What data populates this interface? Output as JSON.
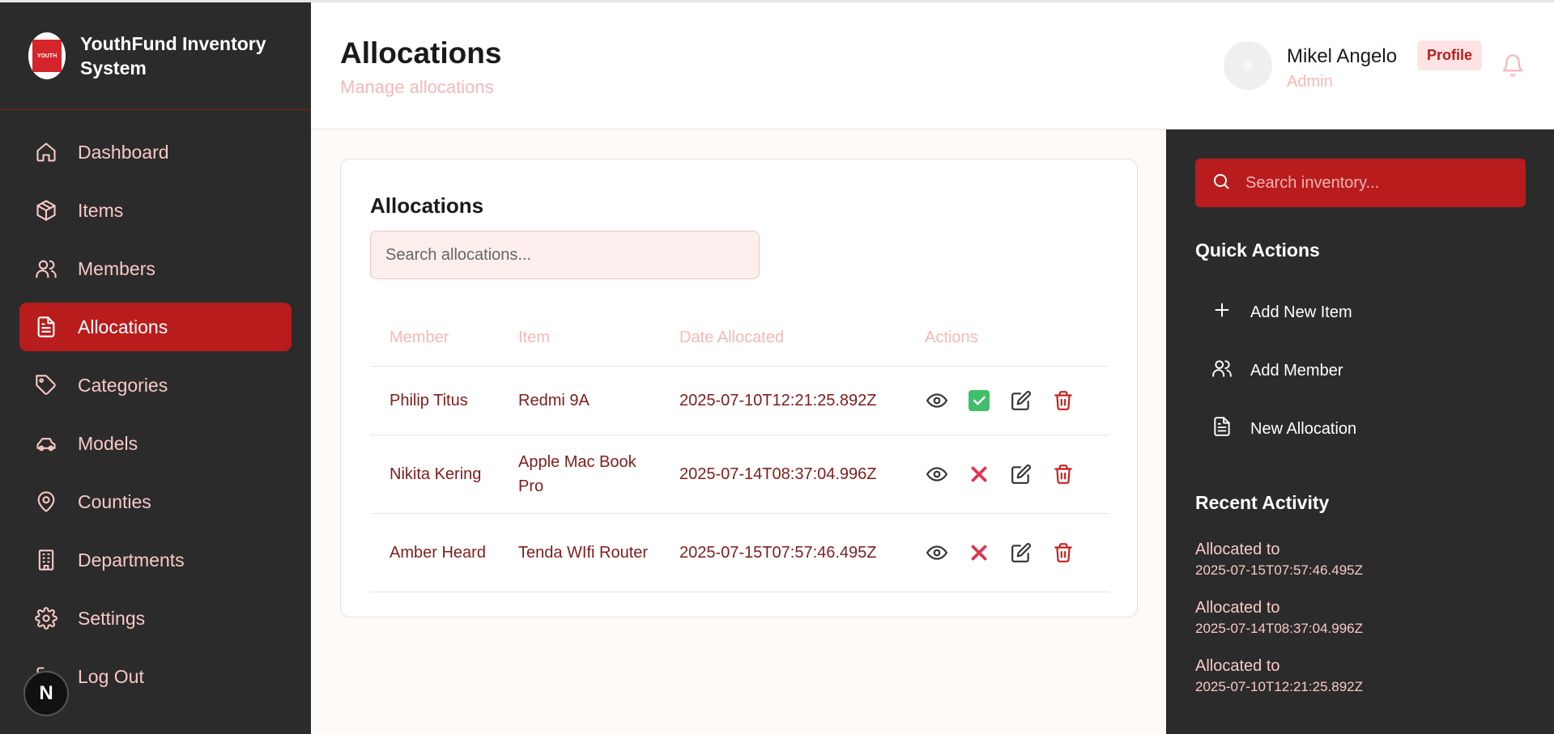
{
  "brand": {
    "title": "YouthFund Inventory System",
    "logo_text": "YOUTH"
  },
  "sidebar": {
    "items": [
      {
        "label": "Dashboard",
        "icon": "home-icon"
      },
      {
        "label": "Items",
        "icon": "box-icon"
      },
      {
        "label": "Members",
        "icon": "users-icon"
      },
      {
        "label": "Allocations",
        "icon": "file-icon",
        "active": true
      },
      {
        "label": "Categories",
        "icon": "tag-icon"
      },
      {
        "label": "Models",
        "icon": "car-icon"
      },
      {
        "label": "Counties",
        "icon": "map-pin-icon"
      },
      {
        "label": "Departments",
        "icon": "building-icon"
      },
      {
        "label": "Settings",
        "icon": "gear-icon"
      },
      {
        "label": "Log Out",
        "icon": "logout-icon"
      }
    ]
  },
  "header": {
    "title": "Allocations",
    "subtitle": "Manage allocations",
    "user_name": "Mikel Angelo",
    "user_role": "Admin",
    "profile_label": "Profile"
  },
  "main": {
    "card_title": "Allocations",
    "search_placeholder": "Search allocations...",
    "columns": [
      "Member",
      "Item",
      "Date Allocated",
      "Actions"
    ],
    "rows": [
      {
        "member": "Philip Titus",
        "item": "Redmi 9A",
        "date": "2025-07-10T12:21:25.892Z",
        "status": "approved"
      },
      {
        "member": "Nikita Kering",
        "item": "Apple Mac Book Pro",
        "date": "2025-07-14T08:37:04.996Z",
        "status": "rejected"
      },
      {
        "member": "Amber Heard",
        "item": "Tenda WIfi Router",
        "date": "2025-07-15T07:57:46.495Z",
        "status": "rejected"
      }
    ]
  },
  "right": {
    "search_placeholder": "Search inventory...",
    "quick_actions_title": "Quick Actions",
    "quick_actions": [
      {
        "label": "Add New Item",
        "icon": "plus-icon"
      },
      {
        "label": "Add Member",
        "icon": "users-icon"
      },
      {
        "label": "New Allocation",
        "icon": "file-icon"
      }
    ],
    "recent_activity_title": "Recent Activity",
    "recent_activity": [
      {
        "text": "Allocated to",
        "date": "2025-07-15T07:57:46.495Z"
      },
      {
        "text": "Allocated to",
        "date": "2025-07-14T08:37:04.996Z"
      },
      {
        "text": "Allocated to",
        "date": "2025-07-10T12:21:25.892Z"
      }
    ]
  },
  "colors": {
    "primary": "#b91c1c",
    "sidebar_bg": "#2b2b2b",
    "accent_text": "#f6b8b8"
  }
}
